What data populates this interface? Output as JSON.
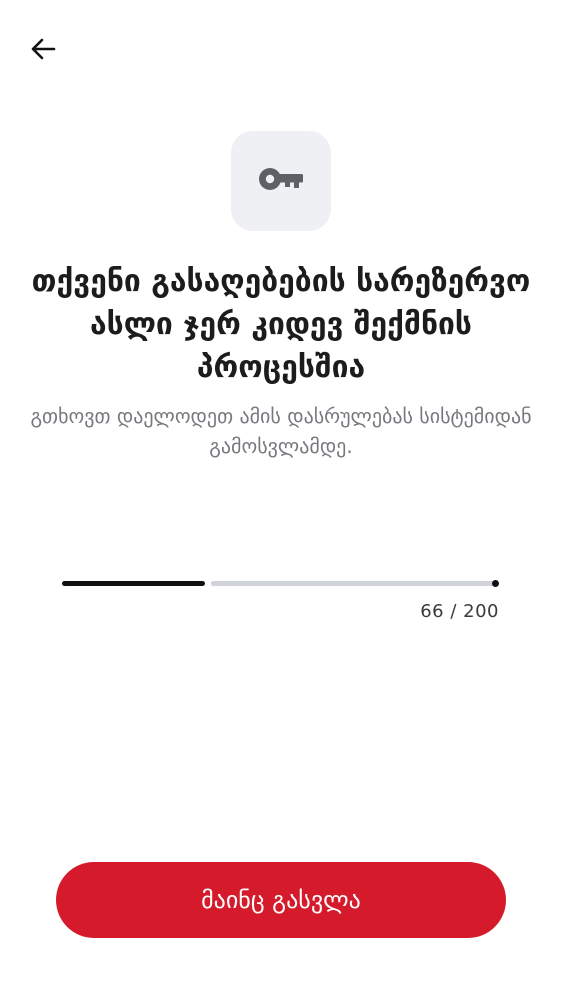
{
  "header": {
    "back_icon": "arrow-left-icon"
  },
  "hero": {
    "icon": "key-icon",
    "icon_color": "#5e6068",
    "tile_color": "#eff0f4"
  },
  "content": {
    "title": "თქვენი გასაღებების სარეზერვო ასლი ჯერ კიდევ შექმნის პროცესშია",
    "subtitle": "გთხოვთ დაელოდეთ ამის დასრულებას სისტემიდან გამოსვლამდე."
  },
  "progress": {
    "current": 66,
    "total": 200,
    "label": "66 / 200"
  },
  "footer": {
    "leave_button_label": "მაინც გასვლა",
    "accent_color": "#d51a2b"
  }
}
